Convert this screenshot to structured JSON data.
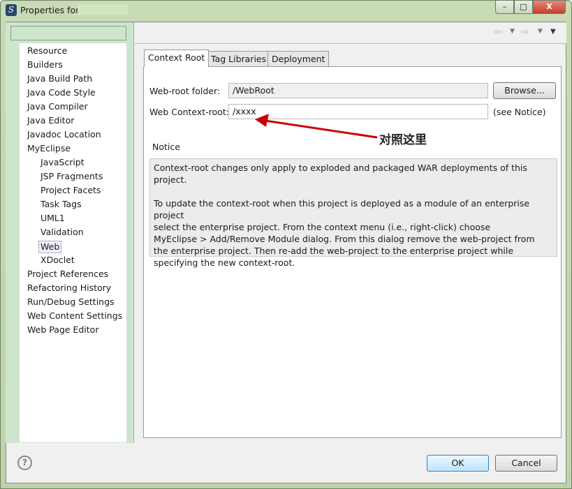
{
  "window": {
    "title": "Properties for",
    "min": "–",
    "max": "□",
    "close": "X"
  },
  "filter": {
    "value": ""
  },
  "tree": [
    {
      "label": "Resource",
      "level": 1
    },
    {
      "label": "Builders",
      "level": 1
    },
    {
      "label": "Java Build Path",
      "level": 1
    },
    {
      "label": "Java Code Style",
      "level": 1
    },
    {
      "label": "Java Compiler",
      "level": 1
    },
    {
      "label": "Java Editor",
      "level": 1
    },
    {
      "label": "Javadoc Location",
      "level": 1
    },
    {
      "label": "MyEclipse",
      "level": 1
    },
    {
      "label": "JavaScript",
      "level": 2
    },
    {
      "label": "JSP Fragments",
      "level": 2
    },
    {
      "label": "Project Facets",
      "level": 2
    },
    {
      "label": "Task Tags",
      "level": 2
    },
    {
      "label": "UML1",
      "level": 2
    },
    {
      "label": "Validation",
      "level": 2
    },
    {
      "label": "Web",
      "level": 2,
      "selected": true
    },
    {
      "label": "XDoclet",
      "level": 2
    },
    {
      "label": "Project References",
      "level": 1
    },
    {
      "label": "Refactoring History",
      "level": 1
    },
    {
      "label": "Run/Debug Settings",
      "level": 1
    },
    {
      "label": "Web Content Settings",
      "level": 1
    },
    {
      "label": "Web Page Editor",
      "level": 1
    }
  ],
  "tabs": [
    {
      "label": "Context Root"
    },
    {
      "label": "Tag Libraries"
    },
    {
      "label": "Deployment"
    }
  ],
  "form": {
    "webroot_label": "Web-root folder:",
    "webroot_value": "/WebRoot",
    "browse": "Browse...",
    "context_label": "Web Context-root:",
    "context_value": "/xxxx",
    "see_notice": "(see Notice)"
  },
  "annotation": "对照这里",
  "notice": {
    "title": "Notice",
    "p1": "Context-root changes only apply to exploded and packaged WAR deployments of this project.",
    "p2": [
      "To update the context-root when this project is deployed as a module of an enterprise project",
      "select the enterprise project. From the context menu (i.e., right-click) choose",
      "MyEclipse > Add/Remove Module dialog. From this dialog remove the web-project from",
      "the enterprise project. Then re-add the web-project to the enterprise project while",
      "specifying the new context-root."
    ]
  },
  "footer": {
    "help": "?",
    "ok": "OK",
    "cancel": "Cancel"
  }
}
